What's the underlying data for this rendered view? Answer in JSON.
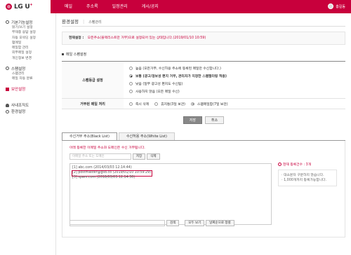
{
  "header": {
    "logo_text": "LG U",
    "logo_plus": "+",
    "nav": [
      "메일",
      "주소록",
      "일정관리",
      "게시/공지"
    ],
    "user_name": "홍길동"
  },
  "sidebar": {
    "groups": [
      {
        "title": "기본기능설정",
        "icon": "gear-icon",
        "items": [
          "읽기/쓰기 설정",
          "부재중 응답 설정",
          "자동 포워딩 설정",
          "펌메일",
          "메일함 관리",
          "외부메일 설정",
          "개인정보 변경"
        ]
      },
      {
        "title": "스팸설정",
        "icon": "gear-icon",
        "items": [
          "스팸관리",
          "메일 자동 분류"
        ]
      }
    ],
    "security": "보안설정",
    "extra": [
      {
        "title": "사내조직도",
        "icon": "org-icon"
      },
      {
        "title": "환경설정",
        "icon": "gear-icon"
      }
    ]
  },
  "main": {
    "title": "환경설정",
    "breadcrumb": "스팸관리",
    "status_label": "현재설정 :",
    "status_value": "모든주소(블랙리스트만 거부)으로 설정되어 있는 상태입니다.(2019/01/10 10:59)",
    "section_title": "메일 스팸설정",
    "spam_level_label": "스팸등급 설정",
    "spam_options": [
      "높음 (모든거부, 수신허용 주소에 등록된 메일만 수신합니다.)",
      "보통 (광고/정보성 편지 거부, 관리자가 지정한 스팸필터링 적용)",
      "낮음 (일부 광고성 편지도 수신됨)",
      "사용하지 않음 (모든 메일 수신)"
    ],
    "spam_selected": 1,
    "reject_label": "거부된 메일 처리",
    "reject_options": [
      "즉시 삭제",
      "휴지통(3일 보관)",
      "스팸메일함(7일 보관)"
    ],
    "reject_selected": 2,
    "save_label": "저장",
    "cancel_label": "취소",
    "tabs": [
      "수신거부 주소(Black List)",
      "수신허용 주소(White List)"
    ],
    "desc": "아래 등록한 이메일 주소와 도메인은 수신 거부됩니다.",
    "input_placeholder": "이메일 주소 또는 도메인",
    "add_label": "저장",
    "delete_label": "삭제",
    "list": [
      "[1] abc.com (2014/03/03 12:14:44)",
      "[2] postmaster@gsd.co (2019/01/10 10:59:29)",
      "[3] spam.com (2018/03/03 12:14:30)"
    ],
    "selected_index": 1,
    "search_label": "검색",
    "view_all_label": "모두 보기",
    "sort_label": "날짜순으로 정렬",
    "count_label": "현재 등록건수 : 3개",
    "notes": [
      "대소문자 구분하지 않습니다.",
      "1,000개까지 등록가능합니다."
    ]
  }
}
